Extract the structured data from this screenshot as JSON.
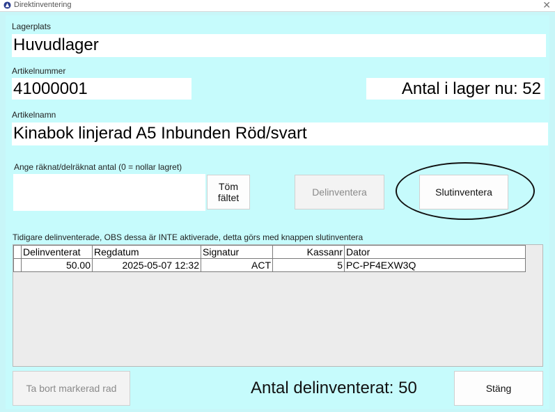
{
  "window": {
    "title": "Direktinventering"
  },
  "location": {
    "label": "Lagerplats",
    "value": "Huvudlager"
  },
  "article_number": {
    "label": "Artikelnummer",
    "value": "41000001"
  },
  "stock_now": "Antal i lager nu: 52",
  "article_name": {
    "label": "Artikelnamn",
    "value": "Kinabok linjerad A5 Inbunden Röd/svart"
  },
  "count_input": {
    "label": "Ange räknat/delräknat antal (0 = nollar lagret)",
    "value": ""
  },
  "buttons": {
    "clear_line1": "Töm",
    "clear_line2": "fältet",
    "partial": "Delinventera",
    "final": "Slutinventera",
    "remove_row": "Ta bort markerad rad",
    "close": "Stäng"
  },
  "grid": {
    "caption": "Tidigare delinventerade, OBS dessa är INTE aktiverade, detta görs med knappen slutinventera",
    "columns": [
      "Delinventerat",
      "Regdatum",
      "Signatur",
      "Kassanr",
      "Dator"
    ],
    "rows": [
      [
        "50.00",
        "2025-05-07 12:32",
        "ACT",
        "5",
        "PC-PF4EXW3Q"
      ]
    ]
  },
  "total_partial": "Antal delinventerat: 50"
}
